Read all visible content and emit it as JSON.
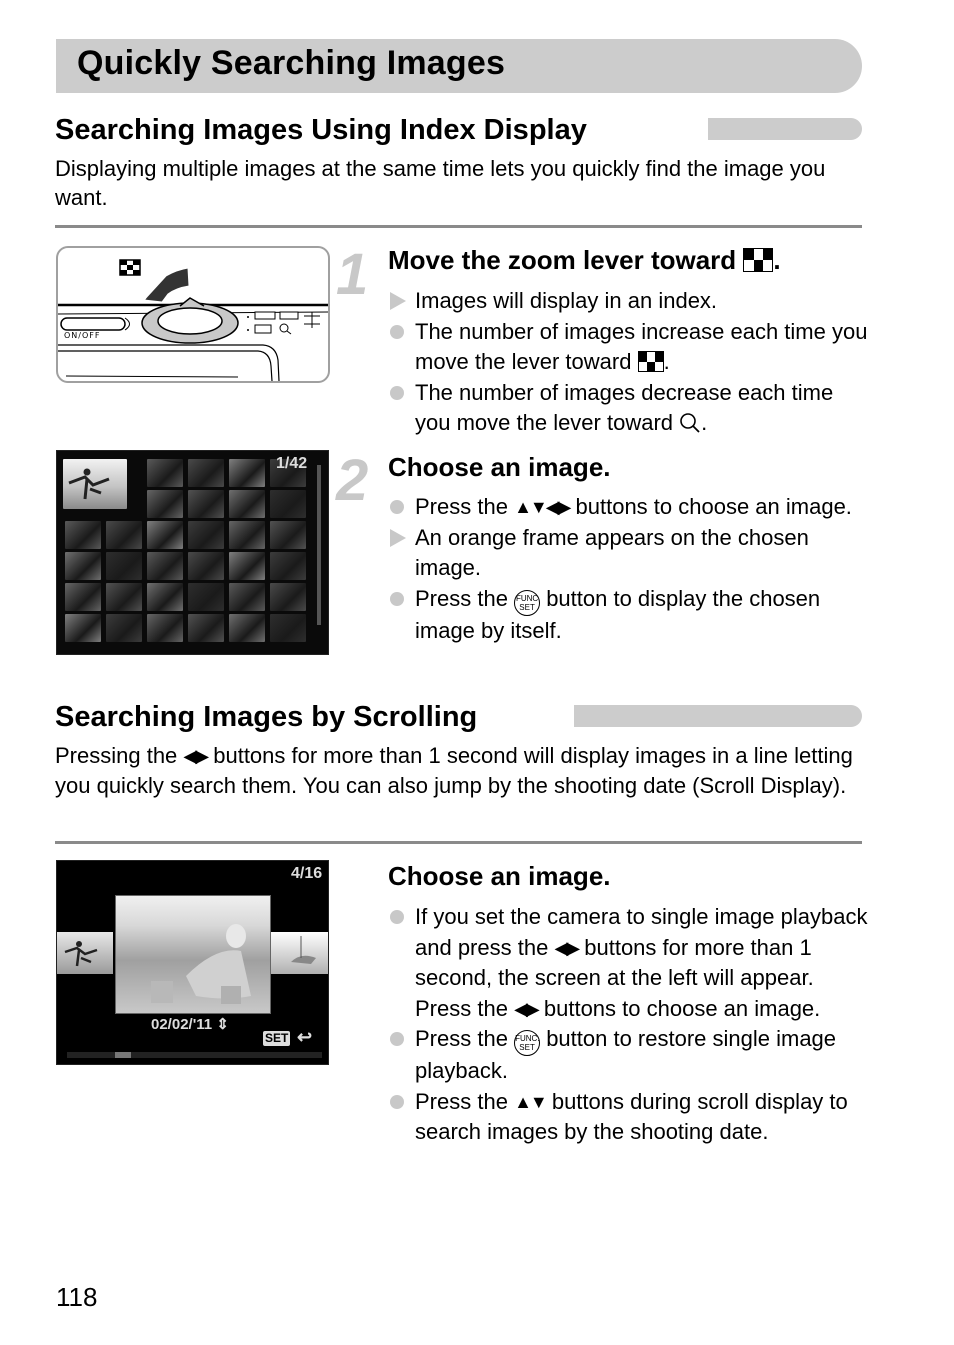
{
  "page": {
    "title": "Quickly Searching Images",
    "page_number": "118"
  },
  "section1": {
    "heading": "Searching Images Using Index Display",
    "intro": "Displaying multiple images at the same time lets you quickly find the image you want.",
    "illustration": {
      "power_label": "ON/OFF",
      "icon": "index-grid-icon"
    },
    "step1": {
      "number": "1",
      "title": "Move the zoom lever toward",
      "title_icon": "index-grid-icon",
      "bullets": [
        {
          "type": "result",
          "text": "Images will display in an index."
        },
        {
          "type": "note",
          "text_a": "The number of images increase each time you move the lever toward",
          "icon": "index-grid-icon",
          "text_b": "."
        },
        {
          "type": "note",
          "text_a": "The number of images decrease each time you move the lever toward",
          "icon": "magnify-icon",
          "text_b": "."
        }
      ]
    },
    "index_screen": {
      "counter": "1/42"
    },
    "step2": {
      "number": "2",
      "title": "Choose an image.",
      "bullets": [
        {
          "type": "note",
          "text_a": "Press the",
          "icon": "up-down-left-right-arrows-icon",
          "glyph": "▲▼◀▶",
          "text_b": "buttons to choose an image."
        },
        {
          "type": "result",
          "text": "An orange frame appears on the chosen image."
        },
        {
          "type": "note",
          "text_a": "Press the",
          "icon": "func-set-button-icon",
          "icon_top": "FUNC",
          "icon_bottom": "SET",
          "text_b": "button to display the chosen image by itself."
        }
      ]
    }
  },
  "section2": {
    "heading": "Searching Images by Scrolling",
    "intro_a": "Pressing the",
    "intro_glyph": "◀▶",
    "intro_b": "buttons for more than 1 second will display images in a line letting you quickly search them. You can also jump by the shooting date (Scroll Display).",
    "scroll_screen": {
      "counter": "4/16",
      "date": "02/02/'11",
      "date_icon": "⇕",
      "set_label": "SET",
      "back_icon": "↩",
      "scroll_position": 0.2
    },
    "step": {
      "title": "Choose an image.",
      "bullets": [
        {
          "type": "note",
          "text_a": "If you set the camera to single image playback and press the",
          "glyph": "◀▶",
          "text_b": "buttons for more than 1 second, the screen at the left will appear. Press the",
          "glyph2": "◀▶",
          "text_c": "buttons to choose an image."
        },
        {
          "type": "note",
          "text_a": "Press the",
          "icon_top": "FUNC.",
          "icon_bottom": "SET",
          "text_b": "button to restore single image playback."
        },
        {
          "type": "note",
          "text_a": "Press the",
          "glyph": "▲▼",
          "text_b": "buttons during scroll display to search images by the shooting date."
        }
      ]
    }
  }
}
